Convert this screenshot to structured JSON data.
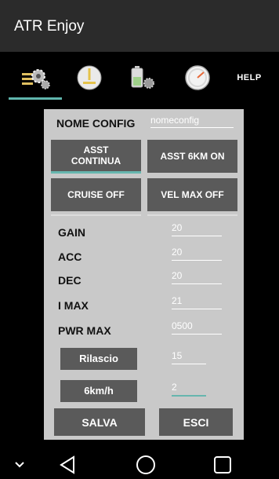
{
  "app": {
    "title": "ATR Enjoy"
  },
  "tabs": {
    "help_label": "HELP"
  },
  "config": {
    "name_label": "NOME CONFIG",
    "name_value": "nomeconfig",
    "buttons": {
      "asst_continua": "ASST\nCONTINUA",
      "asst_6km": "ASST 6KM ON",
      "cruise": "CRUISE OFF",
      "vel_max": "VEL MAX OFF"
    },
    "params": [
      {
        "label": "GAIN",
        "value": "20"
      },
      {
        "label": "ACC",
        "value": "20"
      },
      {
        "label": "DEC",
        "value": "20"
      },
      {
        "label": "I MAX",
        "value": "21"
      },
      {
        "label": "PWR MAX",
        "value": "0500"
      }
    ],
    "rilascio": {
      "label": "Rilascio",
      "value": "15"
    },
    "km6": {
      "label": "6km/h",
      "value": "2"
    },
    "save_label": "SALVA",
    "exit_label": "ESCI"
  }
}
